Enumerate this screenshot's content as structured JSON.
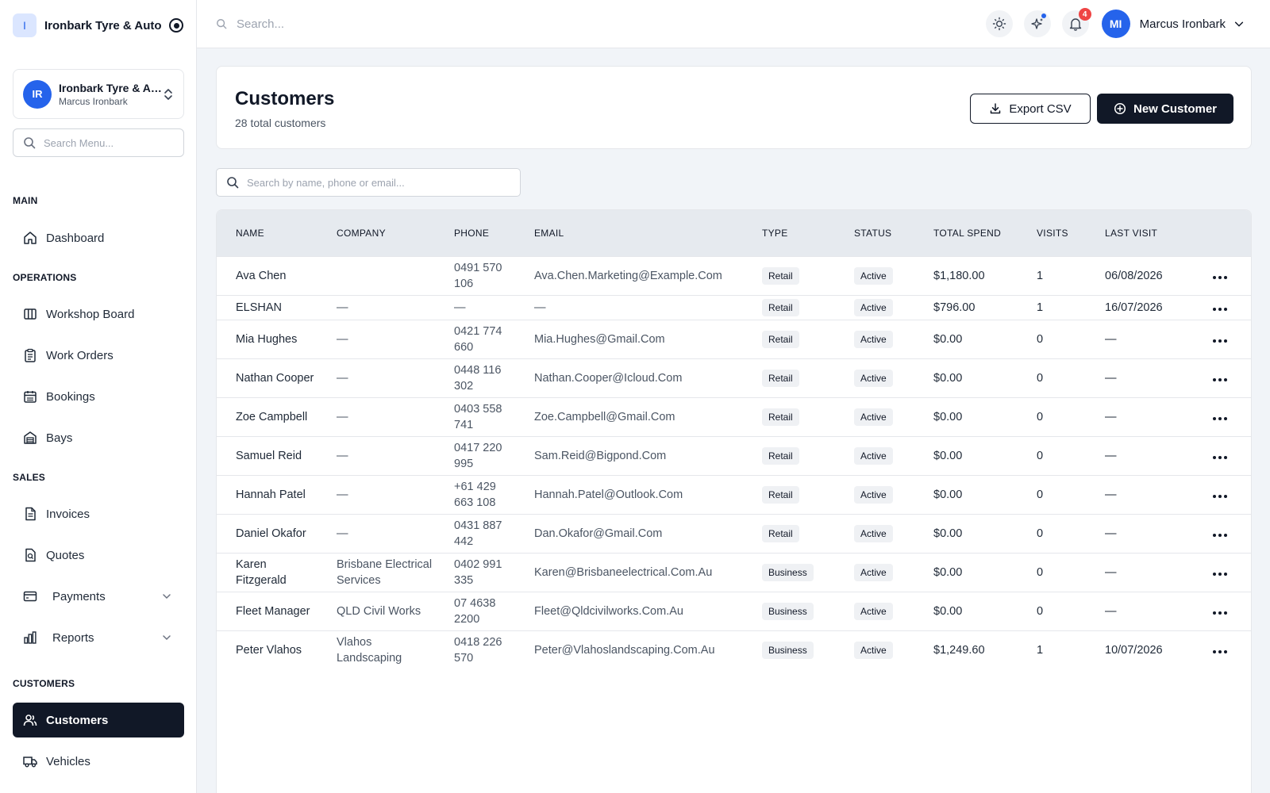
{
  "brand": {
    "logo_letter": "I",
    "name": "Ironbark Tyre & Auto"
  },
  "org": {
    "initials": "IR",
    "name": "Ironbark Tyre & Auto",
    "user": "Marcus Ironbark"
  },
  "sidebar_search": {
    "placeholder": "Search Menu..."
  },
  "nav": {
    "main": {
      "title": "MAIN",
      "dashboard": "Dashboard"
    },
    "operations": {
      "title": "OPERATIONS",
      "workshop_board": "Workshop Board",
      "work_orders": "Work Orders",
      "bookings": "Bookings",
      "bays": "Bays"
    },
    "sales": {
      "title": "SALES",
      "invoices": "Invoices",
      "quotes": "Quotes",
      "payments": "Payments",
      "reports": "Reports"
    },
    "customers": {
      "title": "CUSTOMERS",
      "customers": "Customers",
      "vehicles": "Vehicles"
    }
  },
  "topbar": {
    "search_placeholder": "Search...",
    "notifications_count": "4",
    "user_initials": "MI",
    "user_name": "Marcus Ironbark"
  },
  "page": {
    "title": "Customers",
    "subtitle": "28 total customers",
    "export_label": "Export CSV",
    "new_label": "New Customer"
  },
  "table_search": {
    "placeholder": "Search by name, phone or email..."
  },
  "table": {
    "headers": [
      "NAME",
      "COMPANY",
      "PHONE",
      "EMAIL",
      "TYPE",
      "STATUS",
      "TOTAL SPEND",
      "VISITS",
      "LAST VISIT"
    ],
    "rows": [
      {
        "name": "Ava Chen",
        "company": "",
        "phone": "0491 570 106",
        "email": "Ava.Chen.Marketing@Example.Com",
        "type": "Retail",
        "status": "Active",
        "spend": "$1,180.00",
        "visits": "1",
        "last": "06/08/2026"
      },
      {
        "name": "ELSHAN",
        "company": "—",
        "phone": "—",
        "email": "—",
        "type": "Retail",
        "status": "Active",
        "spend": "$796.00",
        "visits": "1",
        "last": "16/07/2026"
      },
      {
        "name": "Mia Hughes",
        "company": "—",
        "phone": "0421 774 660",
        "email": "Mia.Hughes@Gmail.Com",
        "type": "Retail",
        "status": "Active",
        "spend": "$0.00",
        "visits": "0",
        "last": "—"
      },
      {
        "name": "Nathan Cooper",
        "company": "—",
        "phone": "0448 116 302",
        "email": "Nathan.Cooper@Icloud.Com",
        "type": "Retail",
        "status": "Active",
        "spend": "$0.00",
        "visits": "0",
        "last": "—"
      },
      {
        "name": "Zoe Campbell",
        "company": "—",
        "phone": "0403 558 741",
        "email": "Zoe.Campbell@Gmail.Com",
        "type": "Retail",
        "status": "Active",
        "spend": "$0.00",
        "visits": "0",
        "last": "—"
      },
      {
        "name": "Samuel Reid",
        "company": "—",
        "phone": "0417 220 995",
        "email": "Sam.Reid@Bigpond.Com",
        "type": "Retail",
        "status": "Active",
        "spend": "$0.00",
        "visits": "0",
        "last": "—"
      },
      {
        "name": "Hannah Patel",
        "company": "—",
        "phone": "+61 429 663 108",
        "email": "Hannah.Patel@Outlook.Com",
        "type": "Retail",
        "status": "Active",
        "spend": "$0.00",
        "visits": "0",
        "last": "—"
      },
      {
        "name": "Daniel Okafor",
        "company": "—",
        "phone": "0431 887 442",
        "email": "Dan.Okafor@Gmail.Com",
        "type": "Retail",
        "status": "Active",
        "spend": "$0.00",
        "visits": "0",
        "last": "—"
      },
      {
        "name": "Karen Fitzgerald",
        "company": "Brisbane Electrical Services",
        "phone": "0402 991 335",
        "email": "Karen@Brisbaneelectrical.Com.Au",
        "type": "Business",
        "status": "Active",
        "spend": "$0.00",
        "visits": "0",
        "last": "—"
      },
      {
        "name": "Fleet Manager",
        "company": "QLD Civil Works",
        "phone": "07 4638 2200",
        "email": "Fleet@Qldcivilworks.Com.Au",
        "type": "Business",
        "status": "Active",
        "spend": "$0.00",
        "visits": "0",
        "last": "—"
      },
      {
        "name": "Peter Vlahos",
        "company": "Vlahos Landscaping",
        "phone": "0418 226 570",
        "email": "Peter@Vlahoslandscaping.Com.Au",
        "type": "Business",
        "status": "Active",
        "spend": "$1,249.60",
        "visits": "1",
        "last": "10/07/2026"
      }
    ]
  },
  "colors": {
    "primary_dark": "#111827",
    "accent_blue": "#2563eb",
    "badge_red": "#ef4444",
    "page_bg": "#f1f4f8"
  }
}
